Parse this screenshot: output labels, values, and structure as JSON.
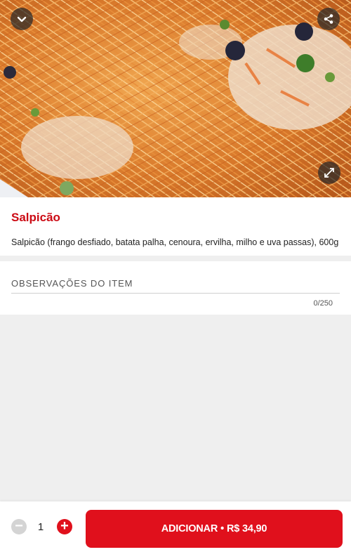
{
  "hero": {
    "image_alt": "Salpicão",
    "icons": {
      "collapse": "chevron-down-icon",
      "share": "share-icon",
      "expand": "expand-icon"
    }
  },
  "product": {
    "name": "Salpicão",
    "description": "Salpicão (frango desfiado, batata palha, cenoura, ervilha, milho e uva passas), 600g"
  },
  "observations": {
    "label": "OBSERVAÇÕES DO ITEM",
    "value": "",
    "counter": "0/250"
  },
  "footer": {
    "quantity": "1",
    "minus_symbol": "−",
    "plus_symbol": "+",
    "add_label": "ADICIONAR",
    "separator": "•",
    "price": "R$ 34,90"
  },
  "colors": {
    "brand": "#e0101c",
    "title": "#cc0a14",
    "background": "#efefef"
  }
}
